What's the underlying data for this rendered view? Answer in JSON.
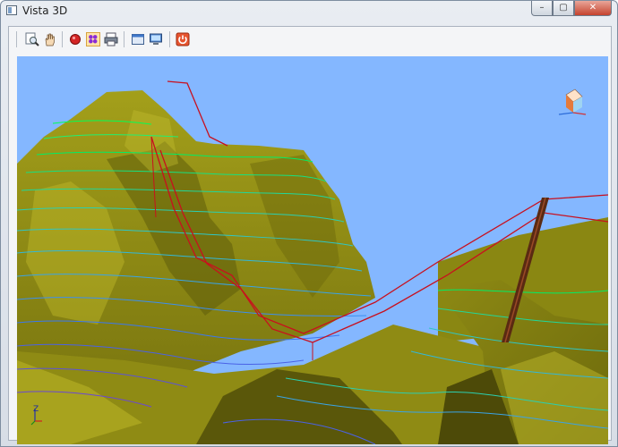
{
  "window": {
    "title": "Vista 3D"
  },
  "titlebar_buttons": {
    "minimize": "–",
    "maximize": "▢",
    "close": "✕"
  },
  "toolbar": {
    "tools": [
      "zoom-extents-icon",
      "pan-hand-icon",
      "stop-icon",
      "layers-icon",
      "print-icon",
      "window-icon",
      "monitor-icon",
      "power-icon"
    ]
  },
  "viewport": {
    "axis_label": "Z",
    "sky_color": "#84b7ff",
    "terrain_color": "#9e9a14",
    "contour_colors": [
      "#00ff66",
      "#33d4c0",
      "#2a8bff",
      "#6a4ce0"
    ],
    "cable_color": "#c8101e"
  }
}
